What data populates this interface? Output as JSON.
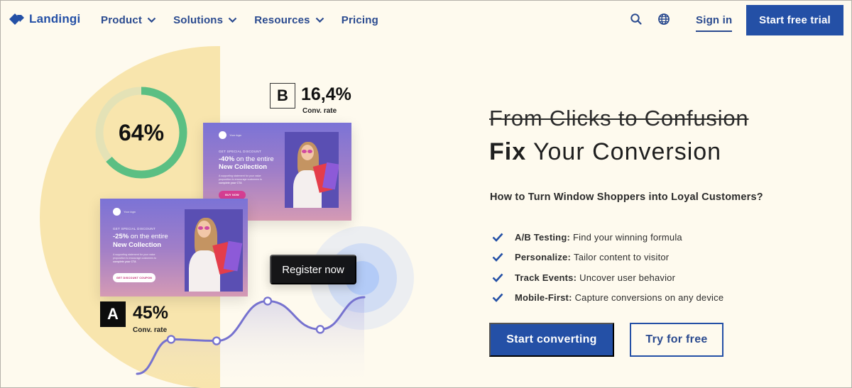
{
  "nav": {
    "logo_text": "Landingi",
    "links": [
      {
        "label": "Product",
        "has_dropdown": true
      },
      {
        "label": "Solutions",
        "has_dropdown": true
      },
      {
        "label": "Resources",
        "has_dropdown": true
      },
      {
        "label": "Pricing",
        "has_dropdown": false
      }
    ],
    "icons": [
      "search-icon",
      "globe-icon"
    ],
    "signin_label": "Sign in",
    "cta_label": "Start free trial"
  },
  "hero": {
    "strikethrough_title": "From Clicks to Confusion",
    "headline_bold": "Fix",
    "headline_rest": " Your Conversion",
    "subheading": "How to Turn Window Shoppers into Loyal Customers?",
    "features": [
      {
        "title": "A/B Testing:",
        "text": "Find your winning formula"
      },
      {
        "title": "Personalize:",
        "text": "Tailor content to visitor"
      },
      {
        "title": "Track Events:",
        "text": "Uncover user behavior"
      },
      {
        "title": "Mobile-First:",
        "text": "Capture conversions on any device"
      }
    ],
    "primary_button": "Start converting",
    "secondary_button": "Try for free"
  },
  "illustration": {
    "progress_ring": {
      "label": "64%",
      "value_percent": 64
    },
    "variant_b": {
      "label": "B",
      "rate": "16,4%",
      "rate_caption": "Conv. rate",
      "ad": {
        "brand": "Your logo",
        "eyebrow": "Get special discount",
        "discount": "-40%",
        "offer_rest": " on the entire",
        "offer_line2": "New Collection",
        "copy_lines": [
          "A supporting statement for your value",
          "proposition to encourage customers to"
        ],
        "copy_bold": "complete your CTA",
        "cta": "BUY NOW"
      }
    },
    "variant_a": {
      "label": "A",
      "rate": "45%",
      "rate_caption": "Conv. rate",
      "ad": {
        "brand": "Your logo",
        "eyebrow": "Get special discount",
        "discount": "-25%",
        "offer_rest": " on the entire",
        "offer_line2": "New Collection",
        "copy_lines": [
          "A supporting statement for your value",
          "proposition to encourage customers to"
        ],
        "copy_bold": "complete your CTA",
        "cta": "GET DISCOUNT COUPON"
      }
    },
    "register_button": "Register now",
    "trend_line_points": [
      0.0,
      0.45,
      0.43,
      0.95,
      0.58,
      1.0
    ],
    "colors": {
      "ring": "#5bbf83",
      "ring_track": "#e4e2b6",
      "line": "#7672cf",
      "half_circle": "#f8e5ad",
      "brand_blue": "#2450a6"
    }
  }
}
